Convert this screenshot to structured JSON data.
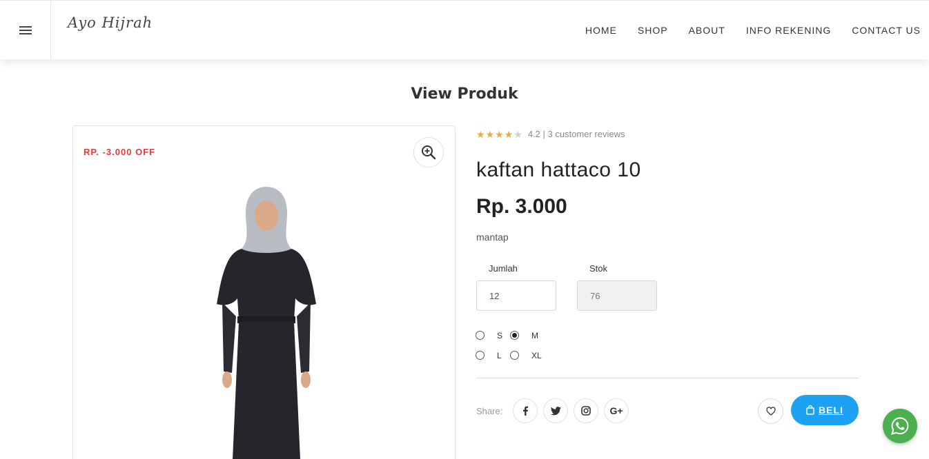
{
  "header": {
    "logo": "Ayo Hijrah",
    "nav": [
      "HOME",
      "SHOP",
      "ABOUT",
      "INFO REKENING",
      "CONTACT US"
    ]
  },
  "page": {
    "title": "View Produk"
  },
  "product": {
    "discount_badge": "RP. -3.000 OFF",
    "rating_value": 4.2,
    "rating_text": "4.2 | 3 customer reviews",
    "name": "kaftan hattaco 10",
    "price": "Rp. 3.000",
    "description": "mantap",
    "qty_label": "Jumlah",
    "qty_value": "12",
    "stock_label": "Stok",
    "stock_value": "76",
    "sizes": [
      "S",
      "M",
      "L",
      "XL"
    ],
    "selected_size": "M"
  },
  "share": {
    "label": "Share:",
    "icons": [
      "facebook-icon",
      "twitter-icon",
      "instagram-icon",
      "google-plus-icon"
    ]
  },
  "actions": {
    "buy_label": "BELI"
  },
  "colors": {
    "accent": "#1da1f2",
    "discount": "#e53935",
    "whatsapp": "#4caf50",
    "star": "#f3a847"
  }
}
